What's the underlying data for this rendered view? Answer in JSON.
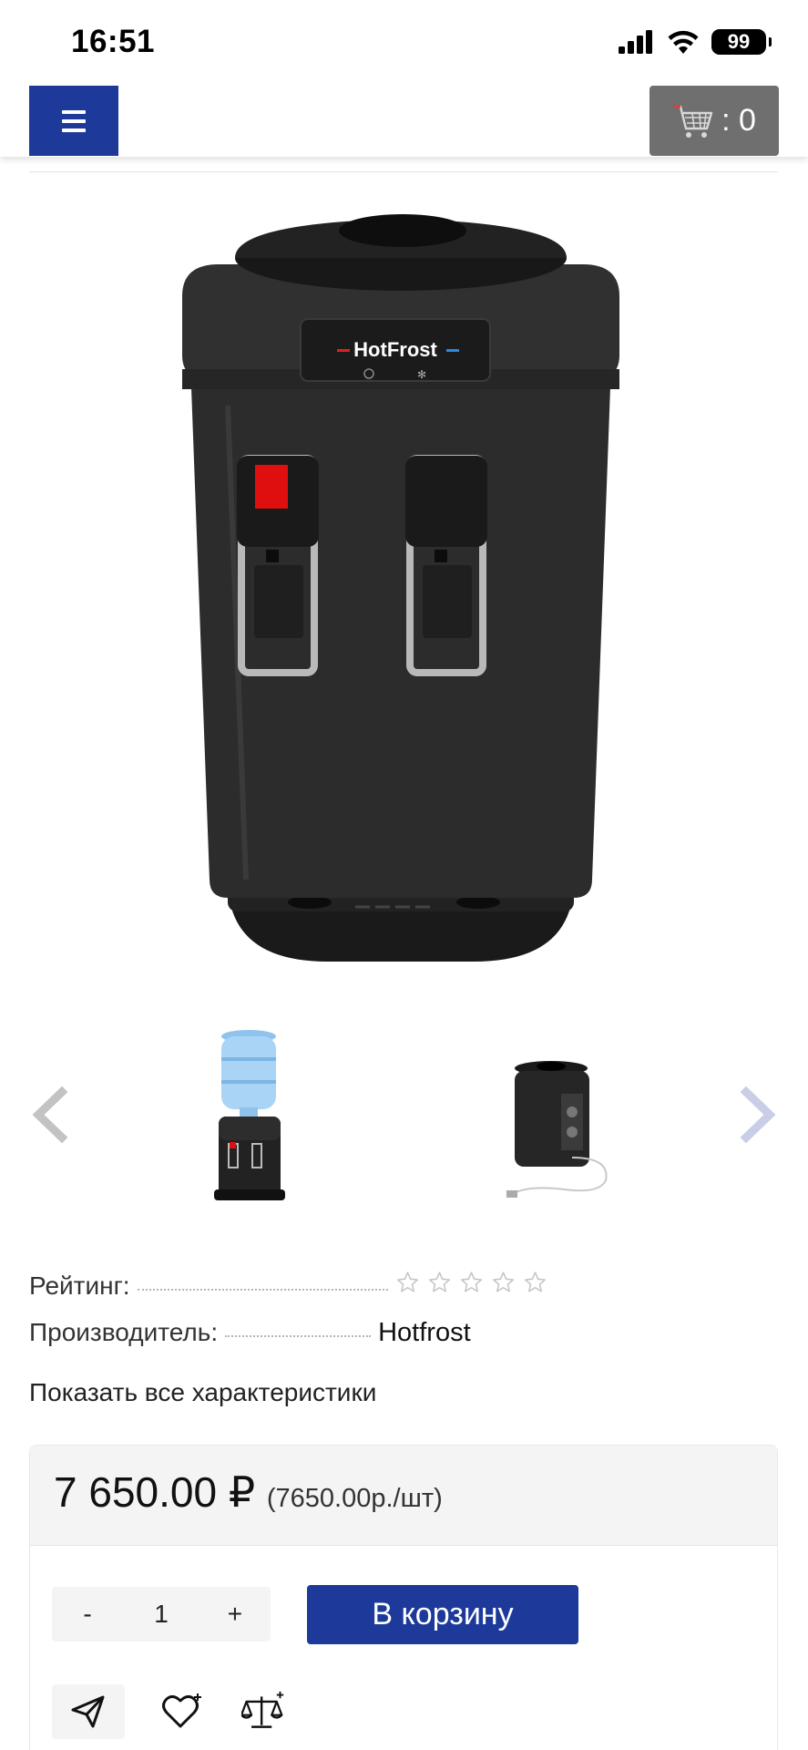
{
  "status_bar": {
    "time": "16:51",
    "battery": "99"
  },
  "header": {
    "cart_label": ": 0"
  },
  "gallery": {
    "prev_icon": "chevron-left-icon",
    "next_icon": "chevron-right-icon"
  },
  "specs": {
    "rating_label": "Рейтинг:",
    "maker_label": "Производитель:",
    "maker_value": "Hotfrost",
    "stars_filled": 0,
    "stars_total": 5
  },
  "show_all_label": "Показать все характеристики",
  "price": {
    "main": "7 650.00 ₽",
    "unit": "(7650.00р./шт)"
  },
  "quantity": {
    "minus": "-",
    "value": "1",
    "plus": "+"
  },
  "add_to_cart_label": "В корзину",
  "colors": {
    "brand_blue": "#1d3a9a",
    "cart_gray": "#6f6f6f"
  }
}
